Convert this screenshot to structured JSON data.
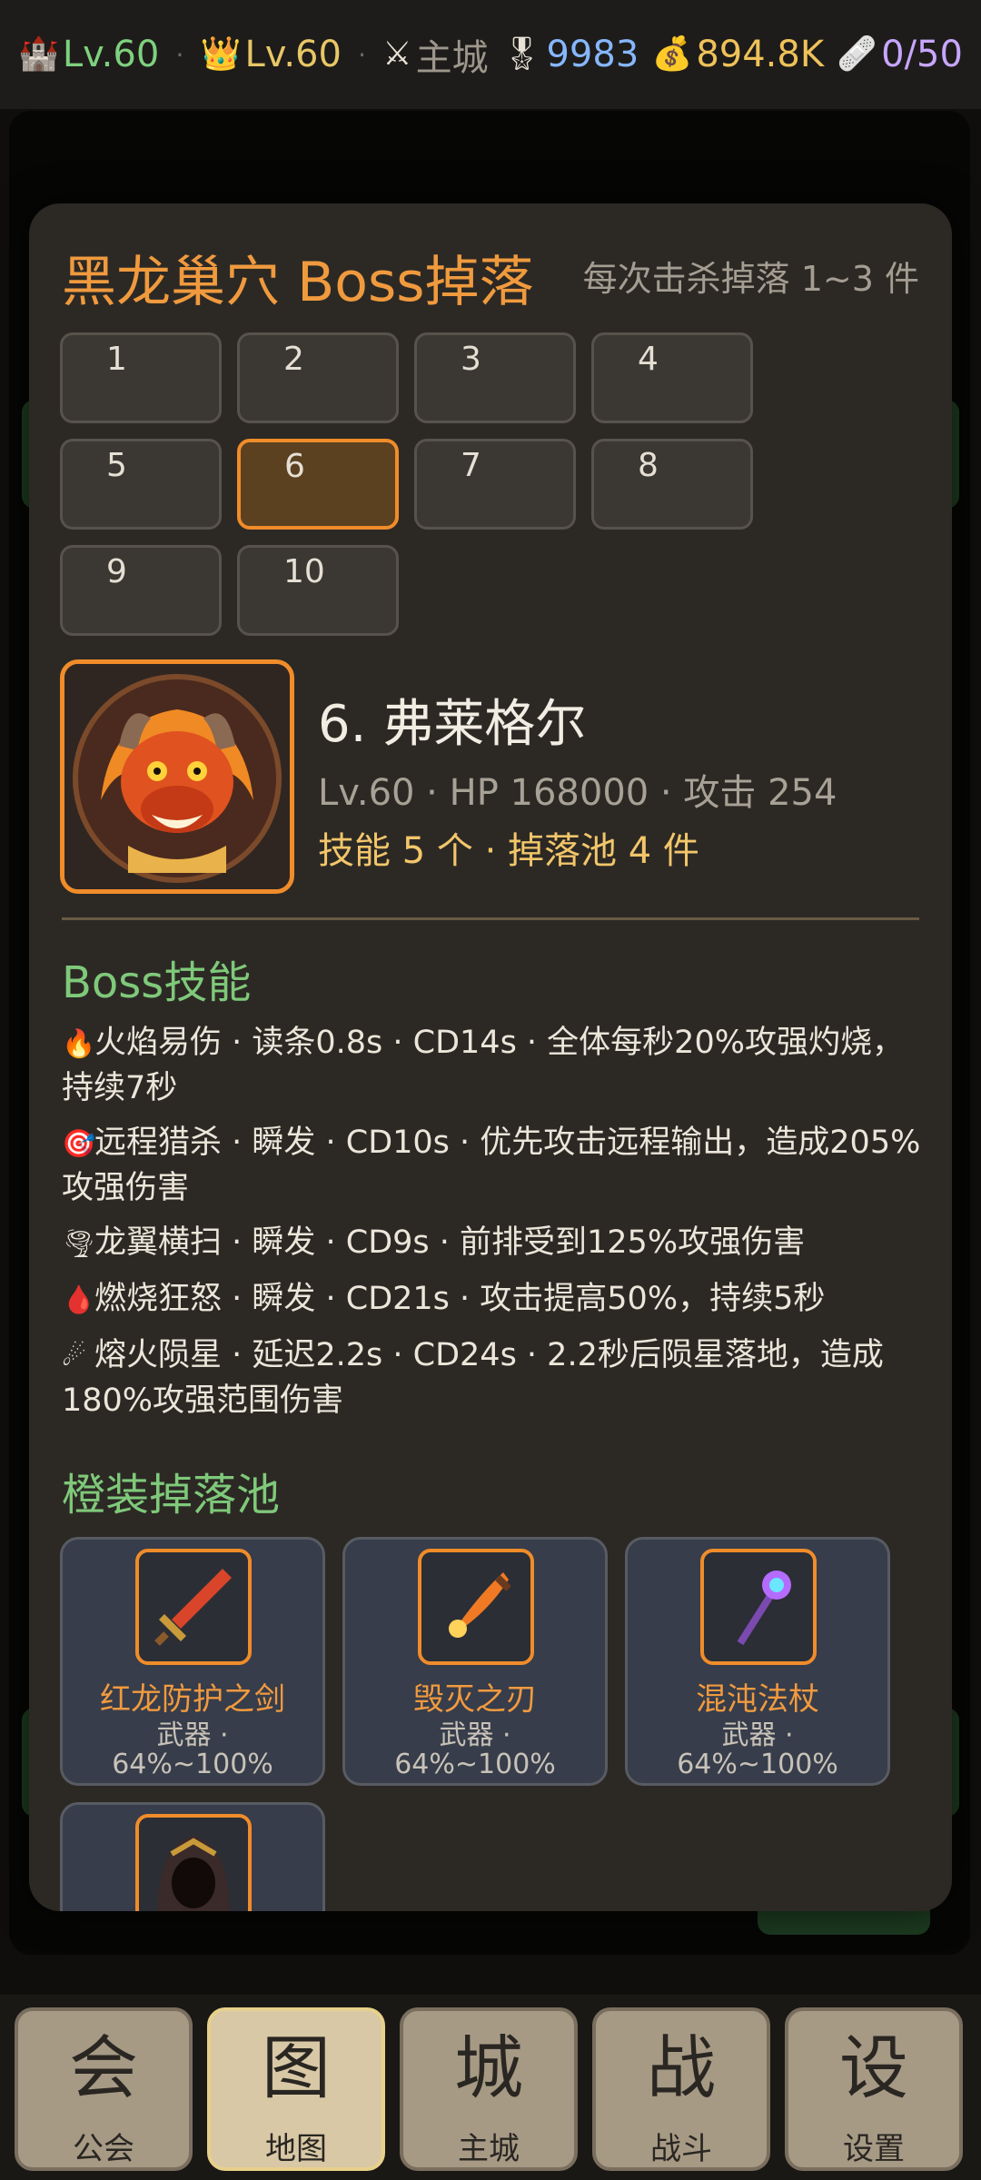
{
  "topbar": {
    "castle_level": "Lv.60",
    "crown_level": "Lv.60",
    "location": "主城",
    "medal": "9983",
    "gold": "894.8K",
    "capacity": "0/50"
  },
  "dialog": {
    "title": "黑龙巢穴 Boss掉落",
    "hint": "每次击杀掉落 1~3 件",
    "boss_tabs": [
      "1",
      "2",
      "3",
      "4",
      "5",
      "6",
      "7",
      "8",
      "9",
      "10"
    ],
    "selected_tab": "6",
    "boss": {
      "name": "6. 弗莱格尔",
      "stats": "Lv.60 · HP 168000 · 攻击 254",
      "summary": "技能 5 个 · 掉落池 4 件"
    },
    "skills_title": "Boss技能",
    "skills": [
      {
        "icon": "fire-icon",
        "glyph": "🔥",
        "text": "火焰易伤 · 读条0.8s · CD14s · 全体每秒20%攻强灼烧，持续7秒"
      },
      {
        "icon": "target-icon",
        "glyph": "🎯",
        "text": "远程猎杀 · 瞬发 · CD10s · 优先攻击远程输出，造成205%攻强伤害"
      },
      {
        "icon": "tornado-icon",
        "glyph": "🌪",
        "text": "龙翼横扫 · 瞬发 · CD9s · 前排受到125%攻强伤害"
      },
      {
        "icon": "blood-drop-icon",
        "glyph": "🩸",
        "text": "燃烧狂怒 · 瞬发 · CD21s · 攻击提高50%，持续5秒"
      },
      {
        "icon": "meteor-icon",
        "glyph": "☄",
        "text": "熔火陨星 · 延迟2.2s · CD24s · 2.2秒后陨星落地，造成180%攻强范围伤害"
      }
    ],
    "loot_title": "橙装掉落池",
    "loot": [
      {
        "name": "红龙防护之剑",
        "type": "武器 ·",
        "range": "64%~100%"
      },
      {
        "name": "毁灭之刃",
        "type": "武器 ·",
        "range": "64%~100%"
      },
      {
        "name": "混沌法杖",
        "type": "武器 ·",
        "range": "64%~100%"
      },
      {
        "name": "",
        "type": "",
        "range": ""
      }
    ]
  },
  "nav": [
    {
      "glyph": "会",
      "label": "公会"
    },
    {
      "glyph": "图",
      "label": "地图"
    },
    {
      "glyph": "城",
      "label": "主城"
    },
    {
      "glyph": "战",
      "label": "战斗"
    },
    {
      "glyph": "设",
      "label": "设置"
    }
  ],
  "nav_active": "地图",
  "colors": {
    "accent_orange": "#f08c2a",
    "section_green": "#7fc97a",
    "dialog_bg": "#2c2925"
  }
}
